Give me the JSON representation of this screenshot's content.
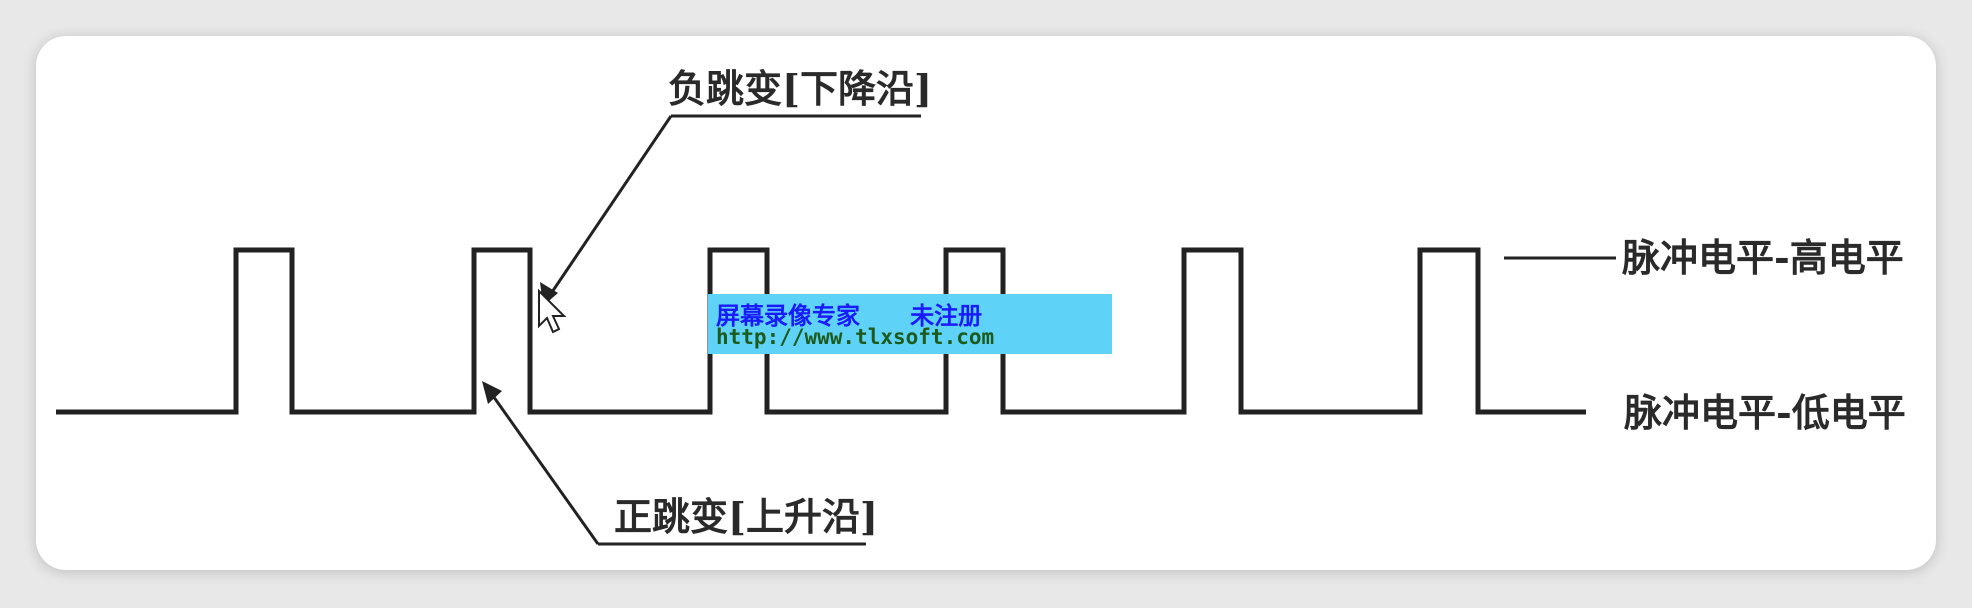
{
  "labels": {
    "falling_edge": "负跳变[下降沿]",
    "rising_edge": "正跳变[上升沿]",
    "high_level": "脉冲电平-高电平",
    "low_level": "脉冲电平-低电平"
  },
  "watermark": {
    "line1": "屏幕录像专家      未注册",
    "line2": "http://www.tlxsoft.com"
  },
  "colors": {
    "waveform": "#222222",
    "watermark_bg": "#5ed2f7",
    "watermark_text": "#1a1aff"
  }
}
